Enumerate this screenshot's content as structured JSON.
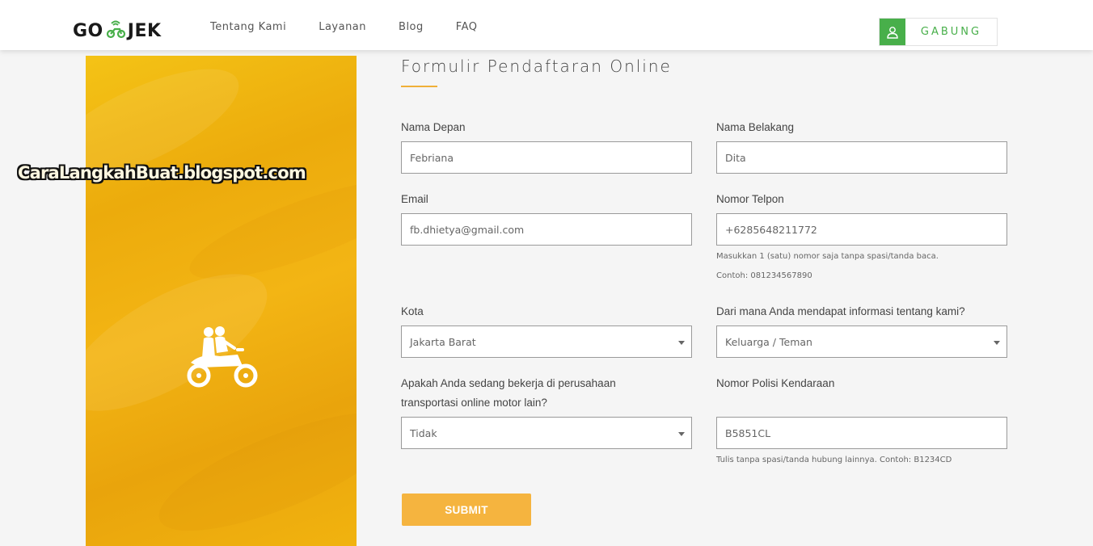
{
  "header": {
    "logo_left": "GO",
    "logo_right": "JEK",
    "nav": [
      "Tentang Kami",
      "Layanan",
      "Blog",
      "FAQ"
    ],
    "join_label": "GABUNG"
  },
  "watermark": "CaraLangkahBuat.blogspot.com",
  "form": {
    "title": "Formulir Pendaftaran Online",
    "first_name": {
      "label": "Nama Depan",
      "value": "Febriana"
    },
    "last_name": {
      "label": "Nama Belakang",
      "value": "Dita"
    },
    "email": {
      "label": "Email",
      "value": "fb.dhietya@gmail.com"
    },
    "phone": {
      "label": "Nomor Telpon",
      "value": "+6285648211772",
      "hint1": "Masukkan 1 (satu) nomor saja tanpa spasi/tanda baca.",
      "hint2": "Contoh: 081234567890"
    },
    "city": {
      "label": "Kota",
      "value": "Jakarta Barat"
    },
    "source": {
      "label": "Dari mana Anda mendapat informasi tentang kami?",
      "value": "Keluarga / Teman"
    },
    "working": {
      "label_line1": "Apakah Anda sedang bekerja di perusahaan",
      "label_line2": "transportasi online motor lain?",
      "value": "Tidak"
    },
    "plate": {
      "label": "Nomor Polisi Kendaraan",
      "value": "B5851CL",
      "hint": "Tulis tanpa spasi/tanda hubung lainnya. Contoh: B1234CD"
    },
    "submit_label": "SUBMIT"
  },
  "colors": {
    "accent": "#f5b43f",
    "brand_green": "#48af4a",
    "panel": "#f0b010"
  }
}
